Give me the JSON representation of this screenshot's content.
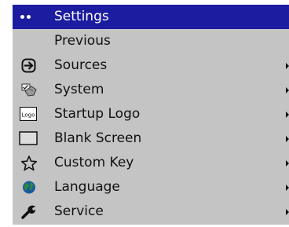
{
  "menu": {
    "title": "Settings",
    "items": [
      {
        "label": "Previous",
        "icon": "none",
        "submenu": false
      },
      {
        "label": "Sources",
        "icon": "source-input-icon",
        "submenu": true
      },
      {
        "label": "System",
        "icon": "system-hands-icon",
        "submenu": true
      },
      {
        "label": "Startup Logo",
        "icon": "logo-icon",
        "icon_text": "Logo",
        "submenu": true
      },
      {
        "label": "Blank Screen",
        "icon": "blank-screen-icon",
        "submenu": true
      },
      {
        "label": "Custom Key",
        "icon": "star-icon",
        "submenu": true
      },
      {
        "label": "Language",
        "icon": "globe-icon",
        "submenu": true
      },
      {
        "label": "Service",
        "icon": "wrench-icon",
        "submenu": true
      }
    ]
  },
  "colors": {
    "header_bg": "#1c1ca0",
    "menu_bg": "#c4c4c4",
    "text": "#111111"
  }
}
